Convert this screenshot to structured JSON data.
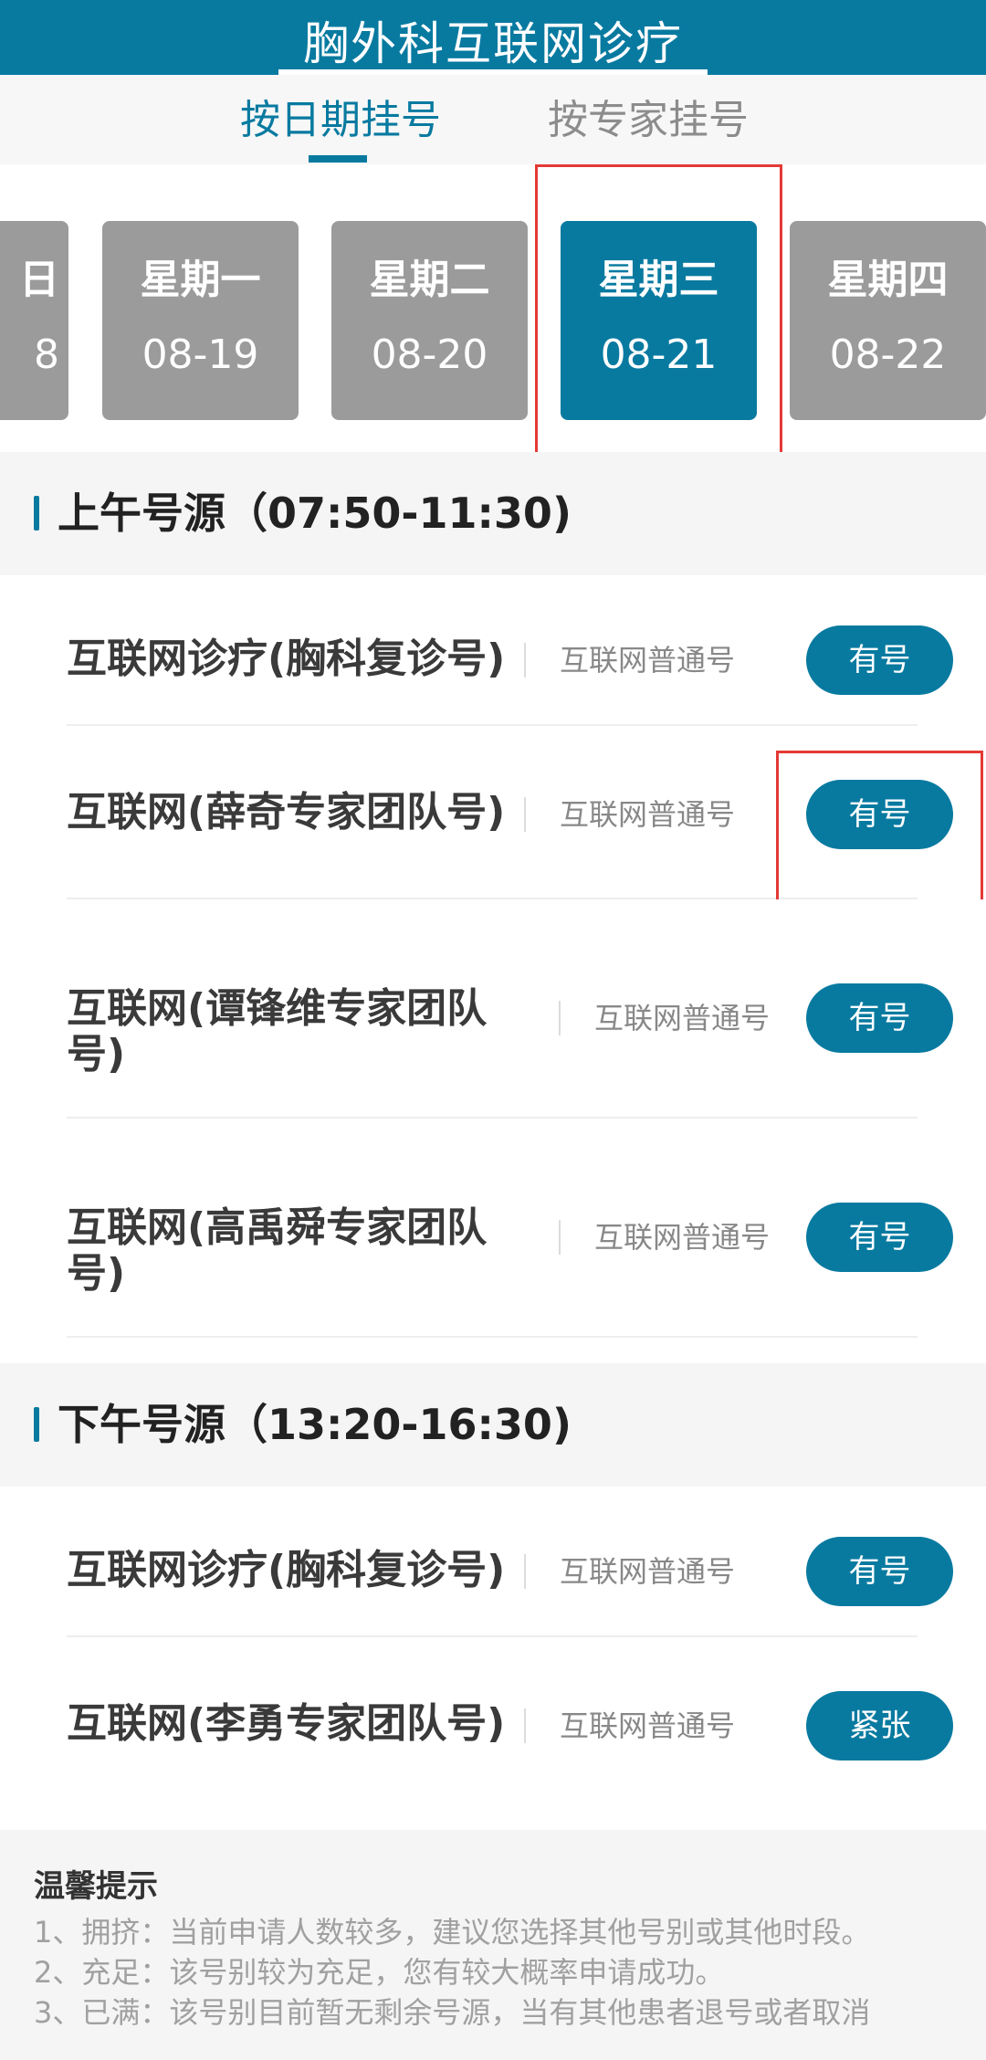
{
  "header": {
    "title": "胸外科互联网诊疗"
  },
  "tabs": [
    {
      "label": "按日期挂号",
      "active": true
    },
    {
      "label": "按专家挂号",
      "active": false
    }
  ],
  "dates": [
    {
      "weekday": "日",
      "date": "8"
    },
    {
      "weekday": "星期一",
      "date": "08-19"
    },
    {
      "weekday": "星期二",
      "date": "08-20"
    },
    {
      "weekday": "星期三",
      "date": "08-21",
      "selected": true
    },
    {
      "weekday": "星期四",
      "date": "08-22"
    }
  ],
  "morning": {
    "title": "上午号源（07:50-11:30)",
    "rows": [
      {
        "name": "互联网诊疗(胸科复诊号)",
        "type": "互联网普通号",
        "status": "有号"
      },
      {
        "name": "互联网(薛奇专家团队号)",
        "type": "互联网普通号",
        "status": "有号"
      },
      {
        "name": "互联网(谭锋维专家团队号)",
        "name_line1": "互联网(谭锋维专家团队",
        "name_line2": "号)",
        "type": "互联网普通号",
        "status": "有号"
      },
      {
        "name": "互联网(高禹舜专家团队号)",
        "name_line1": "互联网(高禹舜专家团队",
        "name_line2": "号)",
        "type": "互联网普通号",
        "status": "有号"
      }
    ]
  },
  "afternoon": {
    "title": "下午号源（13:20-16:30)",
    "rows": [
      {
        "name": "互联网诊疗(胸科复诊号)",
        "type": "互联网普通号",
        "status": "有号"
      },
      {
        "name": "互联网(李勇专家团队号)",
        "type": "互联网普通号",
        "status": "紧张"
      }
    ]
  },
  "tips": {
    "title": "温馨提示",
    "lines": [
      "1、拥挤：当前申请人数较多，建议您选择其他号别或其他时段。",
      "2、充足：该号别较为充足，您有较大概率申请成功。",
      "3、已满：该号别目前暂无剩余号源，当有其他患者退号或者取消"
    ]
  },
  "colors": {
    "accent": "#087aa0",
    "card_gray": "#9b9b9b",
    "highlight_red": "#e53935"
  }
}
